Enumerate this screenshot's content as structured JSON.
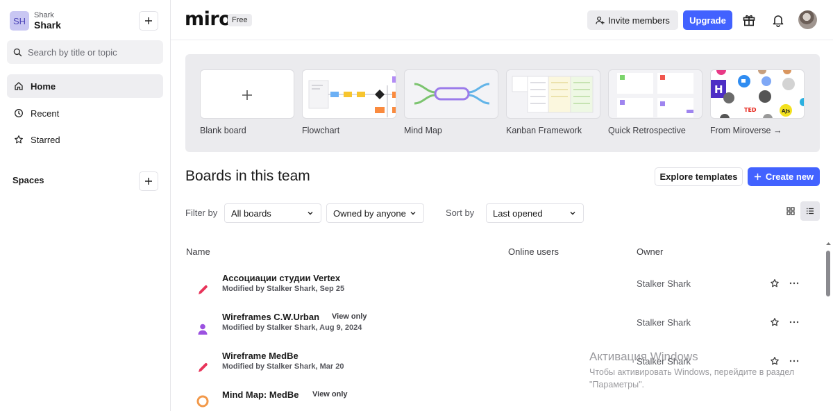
{
  "sidebar": {
    "team_initials": "SH",
    "team_subtitle": "Shark",
    "team_name": "Shark",
    "search_placeholder": "Search by title or topic",
    "nav": [
      {
        "label": "Home",
        "icon": "home-icon"
      },
      {
        "label": "Recent",
        "icon": "clock-icon"
      },
      {
        "label": "Starred",
        "icon": "star-icon"
      }
    ],
    "spaces_label": "Spaces"
  },
  "header": {
    "logo": "miro",
    "plan_badge": "Free",
    "invite_label": "Invite members",
    "upgrade_label": "Upgrade"
  },
  "templates": [
    {
      "label": "Blank board"
    },
    {
      "label": "Flowchart"
    },
    {
      "label": "Mind Map"
    },
    {
      "label": "Kanban Framework"
    },
    {
      "label": "Quick Retrospective"
    },
    {
      "label": "From Miroverse →"
    }
  ],
  "boards": {
    "title": "Boards in this team",
    "explore_label": "Explore templates",
    "create_label": "Create new",
    "filter_label": "Filter by",
    "filter_value": "All boards",
    "owner_filter_value": "Owned by anyone",
    "sort_label": "Sort by",
    "sort_value": "Last opened",
    "columns": {
      "name": "Name",
      "online": "Online users",
      "owner": "Owner"
    },
    "rows": [
      {
        "title": "Ассоциации студии Vertex",
        "badge": "",
        "modified": "Modified by Stalker Shark, Sep 25",
        "owner": "Stalker Shark",
        "icon": "pen-icon"
      },
      {
        "title": "Wireframes C.W.Urban",
        "badge": "View only",
        "modified": "Modified by Stalker Shark, Aug 9, 2024",
        "owner": "Stalker Shark",
        "icon": "user-icon"
      },
      {
        "title": "Wireframe MedBe",
        "badge": "",
        "modified": "Modified by Stalker Shark, Mar 20",
        "owner": "Stalker Shark",
        "icon": "pen-icon"
      },
      {
        "title": "Mind Map: MedBe",
        "badge": "View only",
        "modified": "",
        "owner": "",
        "icon": "mindmap-icon"
      }
    ]
  },
  "watermark": {
    "title": "Активация Windows",
    "text": "Чтобы активировать Windows, перейдите в раздел \"Параметры\"."
  },
  "colors": {
    "accent": "#4262ff",
    "pen": "#e8345a",
    "user": "#9b51e0",
    "mindmap": "#f2994a"
  }
}
